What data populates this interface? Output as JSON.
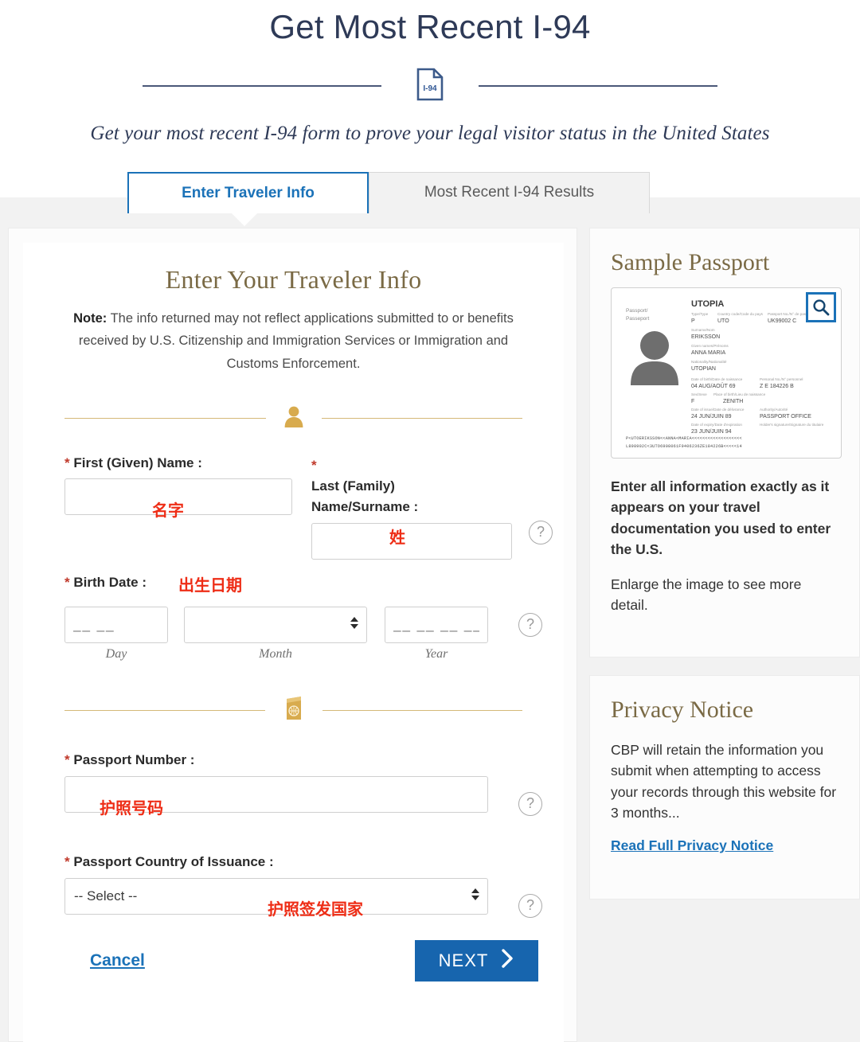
{
  "header": {
    "title": "Get Most Recent I-94",
    "icon_label": "I-94",
    "subtitle": "Get your most recent I-94 form to prove your legal visitor status in the United States"
  },
  "tabs": [
    {
      "label": "Enter Traveler Info",
      "active": true
    },
    {
      "label": "Most Recent I-94 Results",
      "active": false
    }
  ],
  "form": {
    "section_title": "Enter Your Traveler Info",
    "note_prefix": "Note:",
    "note_body": " The info returned may not reflect applications submitted to or benefits received by U.S. Citizenship and Immigration Services or Immigration and Customs Enforcement.",
    "first_name_label": "First (Given) Name :",
    "first_name_annotation": "名字",
    "first_name_value": "",
    "last_name_label": "Last (Family) Name/Surname :",
    "last_name_annotation": "姓",
    "last_name_value": "",
    "birth_date_label": "Birth Date :",
    "birth_date_annotation": "出生日期",
    "day_placeholder": "__ __",
    "day_sublabel": "Day",
    "month_value": "",
    "month_sublabel": "Month",
    "year_placeholder": "__ __ __ __",
    "year_sublabel": "Year",
    "passport_number_label": "Passport Number :",
    "passport_number_annotation": "护照号码",
    "passport_number_value": "",
    "passport_country_label": "Passport Country of Issuance :",
    "passport_country_selected": "-- Select --",
    "passport_country_annotation": "护照签发国家",
    "required_marker": "*",
    "help_glyph": "?",
    "cancel_label": "Cancel",
    "next_label": "NEXT"
  },
  "sidebar": {
    "sample_passport_title": "Sample Passport",
    "instruction_bold": "Enter all information exactly as it appears on your travel documentation you used to enter the U.S.",
    "instruction_note": "Enlarge the image to see more detail.",
    "privacy_title": "Privacy Notice",
    "privacy_body": "CBP will retain the information you submit when attempting to access your records through this website for 3 months...",
    "privacy_link": "Read Full Privacy Notice"
  },
  "passport_sample": {
    "country": "UTOPIA",
    "side_label": "Passport/\nPasseport",
    "type_label": "Type/Type",
    "type_value": "P",
    "code_label": "Country code/Code du pays",
    "code_value": "UTO",
    "number_label": "Passport No./N° de passeport",
    "number_value": "UK99002 C",
    "surname_label": "Surname/Nom",
    "surname_value": "ERIKSSON",
    "given_label": "Given names/Prénoms",
    "given_value": "ANNA MARIA",
    "nationality_label": "Nationality/Nationalité",
    "nationality_value": "UTOPIAN",
    "dob_label": "Date of birth/Date de naissance",
    "dob_value": "04 AUG/AOÛT 69",
    "personal_label": "Personal No./N° personnel",
    "personal_value": "Z E 184226 B",
    "sex_label": "Sex/Sexe",
    "sex_value": "F",
    "pob_label": "Place of birth/Lieu de naissance",
    "pob_value": "ZENITH",
    "issue_label": "Date of issue/Date de délivrance",
    "issue_value": "24 JUN/JUIN 89",
    "authority_label": "Authority/Autorité",
    "authority_value": "PASSPORT OFFICE",
    "expiry_label": "Date of expiry/Date d'expiration",
    "expiry_value": "23 JUN/JUIN 94",
    "signature_label": "Holder's signature/Signature du titulaire",
    "mrz_line1": "P<UTOERIKSSON<<ANNA<MARIA<<<<<<<<<<<<<<<<<<<",
    "mrz_line2": "L898902C<3UTO6908061F9406236ZE184226B<<<<<14",
    "zoom_icon": "search-icon"
  },
  "colors": {
    "title_navy": "#2e3a57",
    "accent_blue": "#1b72b8",
    "gold": "#7a6a45",
    "annotation_red": "#ee2d16",
    "button_blue": "#1765ae",
    "band_gray": "#f2f2f2"
  }
}
